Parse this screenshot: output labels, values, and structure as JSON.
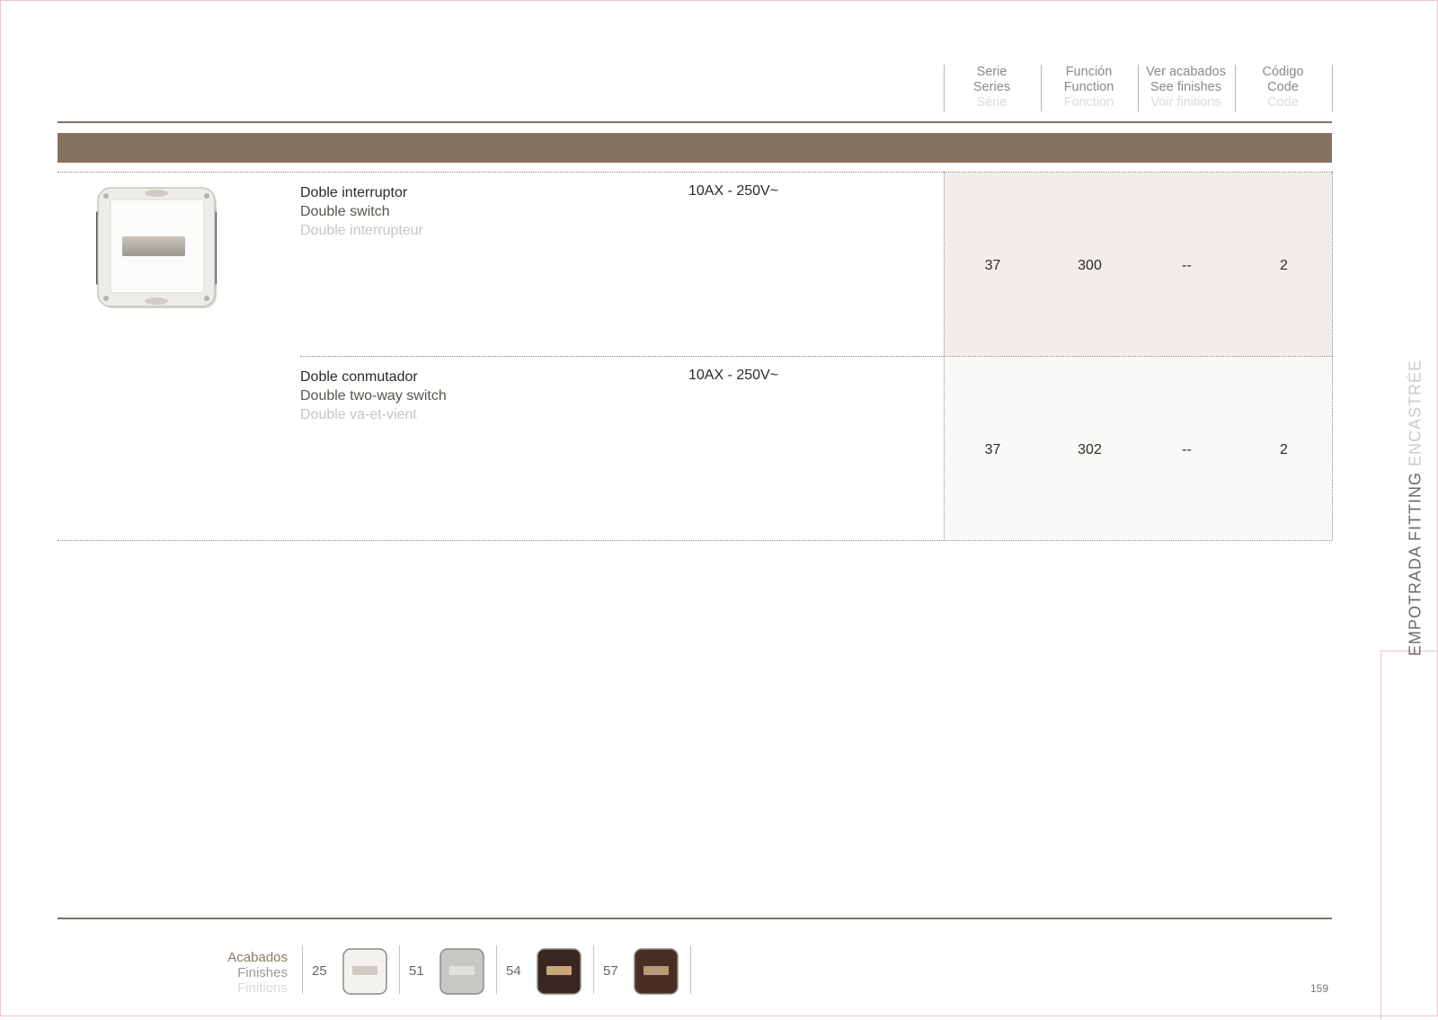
{
  "column_headers": [
    {
      "es": "Serie",
      "en": "Series",
      "fr": "Série"
    },
    {
      "es": "Función",
      "en": "Function",
      "fr": "Fonction"
    },
    {
      "es": "Ver acabados",
      "en": "See finishes",
      "fr": "Voir finitions"
    },
    {
      "es": "Código",
      "en": "Code",
      "fr": "Code"
    }
  ],
  "products": [
    {
      "name_es": "Doble interruptor",
      "name_en": "Double switch",
      "name_fr": "Double interrupteur",
      "rating": "10AX - 250V~",
      "serie": "37",
      "funcion": "300",
      "acabados": "--",
      "codigo": "2",
      "highlight_color": "#f1ede8"
    },
    {
      "name_es": "Doble conmutador",
      "name_en": "Double two-way switch",
      "name_fr": "Double va-et-vient",
      "rating": "10AX - 250V~",
      "serie": "37",
      "funcion": "302",
      "acabados": "--",
      "codigo": "2",
      "highlight_color": "#faf9f7"
    }
  ],
  "side_tab": {
    "part1": "EMPOTRADA FITTING",
    "part2": "ENCASTRÉE"
  },
  "finishes": {
    "label_es": "Acabados",
    "label_en": "Finishes",
    "label_fr": "Finitions",
    "items": [
      {
        "code": "25",
        "frame_color": "#f4f2ee",
        "rocker_color": "#cfcac3"
      },
      {
        "code": "51",
        "frame_color": "#c9c7c4",
        "rocker_color": "#e2e0dd"
      },
      {
        "code": "54",
        "frame_color": "#3a2620",
        "rocker_color": "#c9a77c"
      },
      {
        "code": "57",
        "frame_color": "#4a2e24",
        "rocker_color": "#b99a78"
      }
    ]
  },
  "page_number": "159",
  "colors": {
    "accent_brown": "#857160",
    "tab_border": "#e9c6d0"
  }
}
